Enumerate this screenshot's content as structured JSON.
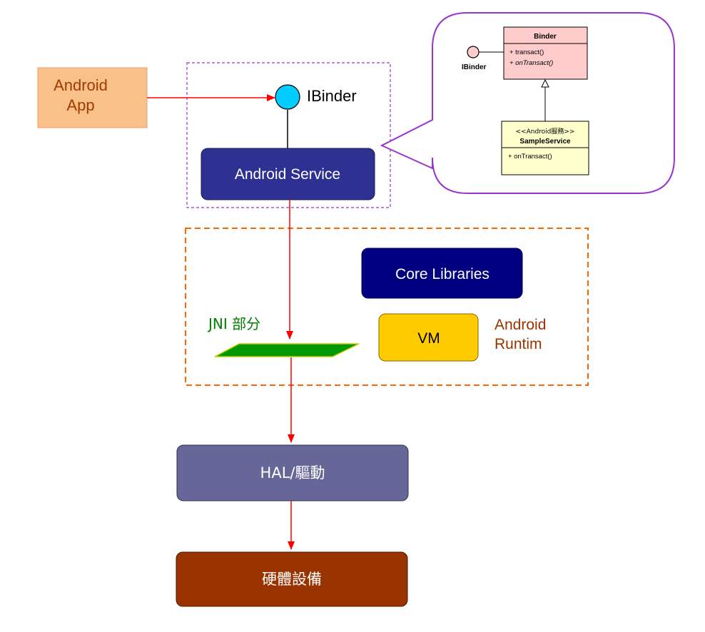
{
  "diagram": {
    "android_app": {
      "line1": "Android",
      "line2": "App"
    },
    "ibinder_label": "IBinder",
    "android_service": "Android Service",
    "core_libraries": "Core Libraries",
    "vm": "VM",
    "android_runtime": {
      "line1": "Android",
      "line2": "Runtim"
    },
    "jni_label": "JNI 部分",
    "hal": "HAL/驅動",
    "hardware": "硬體設備",
    "uml": {
      "interface_label": "IBinder",
      "binder_class": {
        "name": "Binder",
        "methods": [
          "+ transact()",
          "+ onTransact()"
        ]
      },
      "service_class": {
        "stereotype": "<<Android服務>>",
        "name": "SampleService",
        "methods": [
          "+ onTransact()"
        ]
      }
    },
    "colors": {
      "app_fill": "#f9c08a",
      "app_text": "#a03c00",
      "service_fill": "#2e3192",
      "core_fill": "#000080",
      "vm_fill": "#ffcc00",
      "runtime_text": "#993300",
      "jni_text": "#008000",
      "jni_fill": "#009900",
      "hal_fill": "#666699",
      "hardware_fill": "#993300",
      "arrow": "#ff0000",
      "ibinder_fill": "#00ccff",
      "purple_border": "#9933cc",
      "orange_border": "#ff6600",
      "binder_fill": "#ffcccc",
      "service_class_fill": "#ffffcc"
    }
  }
}
